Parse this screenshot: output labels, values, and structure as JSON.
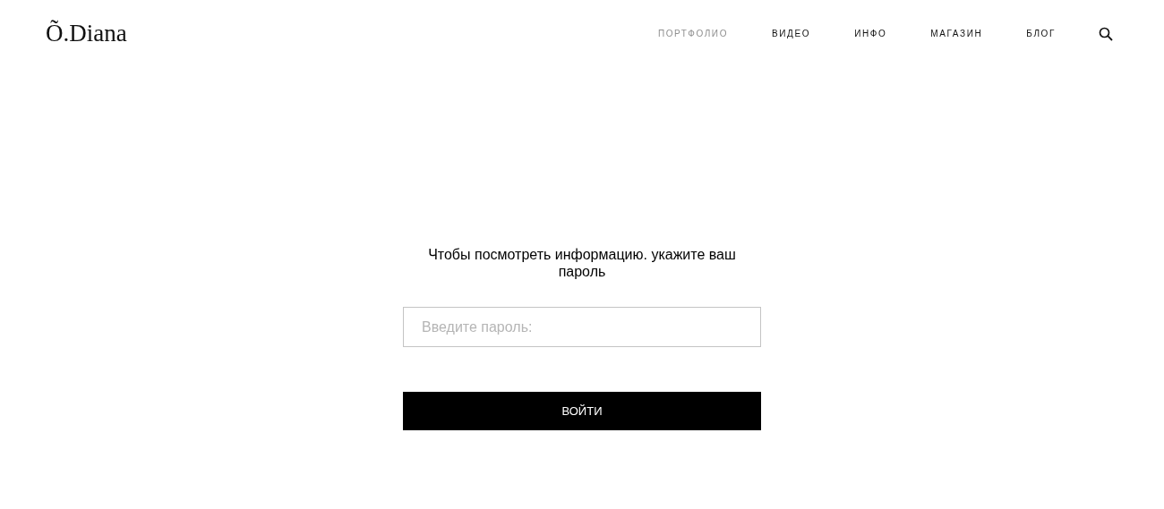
{
  "logo": "Õ.Diana",
  "nav": [
    {
      "label": "ПОРТФОЛИО",
      "selected": true
    },
    {
      "label": "ВИДЕО",
      "selected": false
    },
    {
      "label": "ИНФО",
      "selected": false
    },
    {
      "label": "МАГАЗИН",
      "selected": false
    },
    {
      "label": "БЛОГ",
      "selected": false
    }
  ],
  "message": "Чтобы посмотреть информацию. укажите ваш пароль",
  "password_field": {
    "placeholder": "Введите пароль:"
  },
  "submit_button": "ВОЙТИ"
}
